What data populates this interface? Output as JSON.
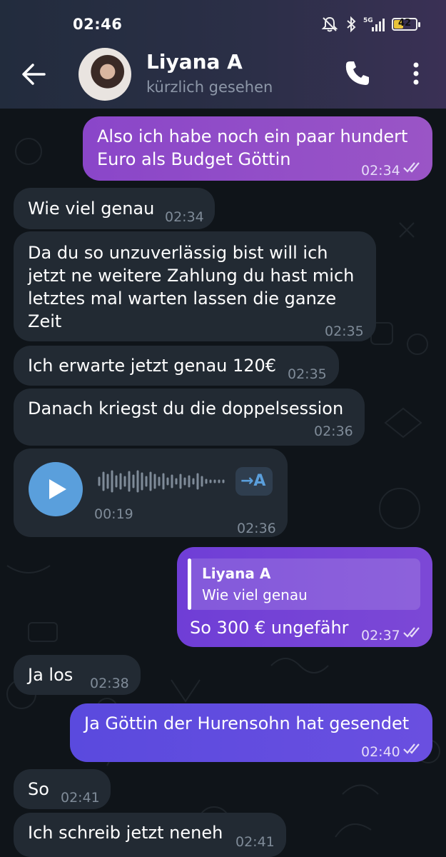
{
  "status_bar": {
    "time": "02:46",
    "battery": "42",
    "network": "5G"
  },
  "header": {
    "contact_name": "Liyana A",
    "contact_status": "kürzlich gesehen"
  },
  "messages": [
    {
      "dir": "out",
      "text_line1": "Also ich habe noch ein paar hundert",
      "text_line2": "Euro als Budget Göttin",
      "time": "02:34"
    },
    {
      "dir": "in",
      "text": "Wie viel genau",
      "time": "02:34"
    },
    {
      "dir": "in",
      "text_line1": "Da du so unzuverlässig bist will ich",
      "text_line2": "jetzt ne weitere Zahlung du hast mich",
      "text_line3": "letztes mal warten lassen die ganze",
      "text_line4": "Zeit",
      "time": "02:35"
    },
    {
      "dir": "in",
      "text": "Ich erwarte jetzt genau 120€",
      "time": "02:35"
    },
    {
      "dir": "in",
      "text": "Danach kriegst du die doppelsession",
      "time": "02:36"
    },
    {
      "dir": "in",
      "type": "voice",
      "duration": "00:19",
      "transcribe_label": "→A",
      "time": "02:36"
    },
    {
      "dir": "out",
      "reply_name": "Liyana A",
      "reply_text": "Wie viel genau",
      "text": "So 300 € ungefähr",
      "time": "02:37"
    },
    {
      "dir": "in",
      "text": "Ja los",
      "time": "02:38"
    },
    {
      "dir": "out",
      "text": "Ja Göttin der Hurensohn hat gesendet",
      "time": "02:40"
    },
    {
      "dir": "in",
      "text": "So",
      "time": "02:41"
    },
    {
      "dir": "in",
      "text": "Ich schreib jetzt neneh",
      "time": "02:41"
    }
  ]
}
